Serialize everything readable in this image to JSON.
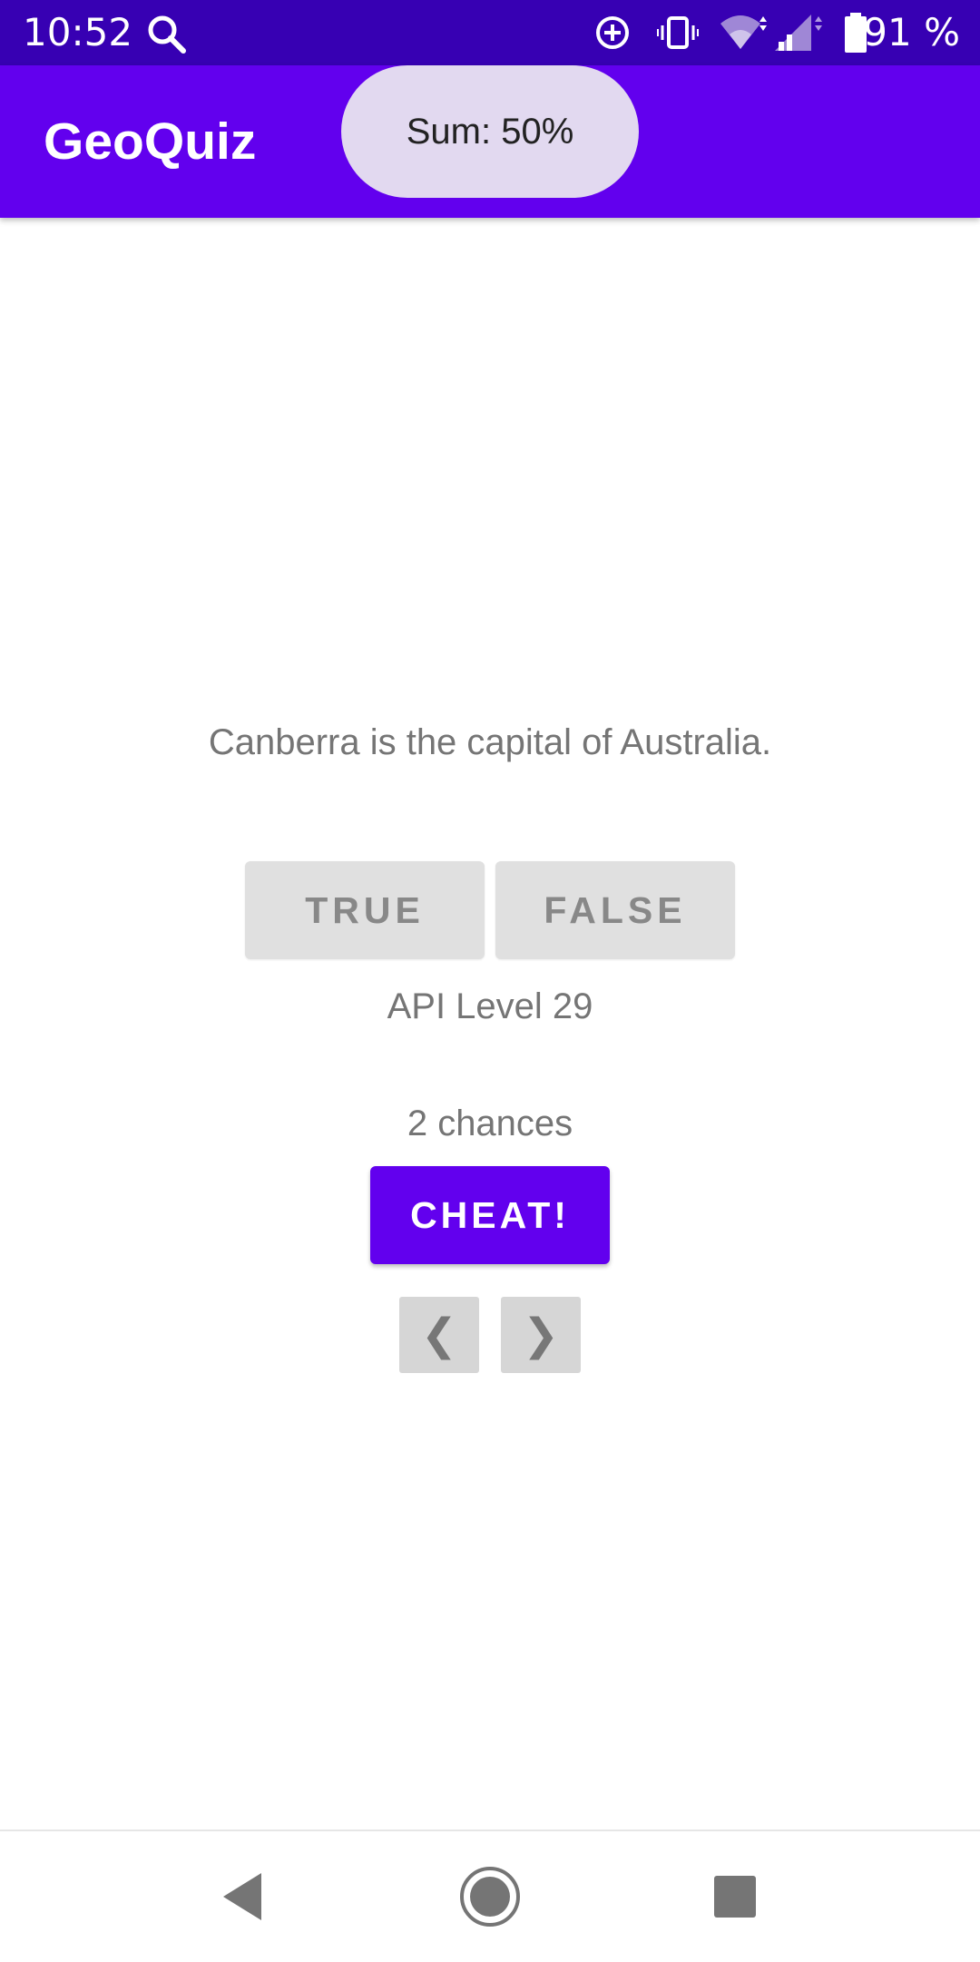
{
  "status_bar": {
    "time": "10:52",
    "battery_percent": "91 %",
    "icons": [
      "search-icon",
      "sync-icon",
      "vibrate-icon",
      "wifi-icon",
      "signal-icon",
      "battery-icon"
    ]
  },
  "app_bar": {
    "title": "GeoQuiz"
  },
  "toast": {
    "text": "Sum: 50%"
  },
  "quiz": {
    "question": "Canberra is the capital of Australia.",
    "true_label": "TRUE",
    "false_label": "FALSE",
    "api_level": "API Level 29",
    "chances": "2 chances",
    "cheat_label": "CHEAT!",
    "prev_label": "❮",
    "next_label": "❯"
  },
  "system_nav": {
    "icons": [
      "back-icon",
      "home-icon",
      "recents-icon"
    ]
  },
  "colors": {
    "status_bar": "#3700b3",
    "app_bar": "#6200ee",
    "accent": "#6200ee",
    "toast_bg": "#e2d9f0",
    "button_bg": "#e0e0e0"
  }
}
